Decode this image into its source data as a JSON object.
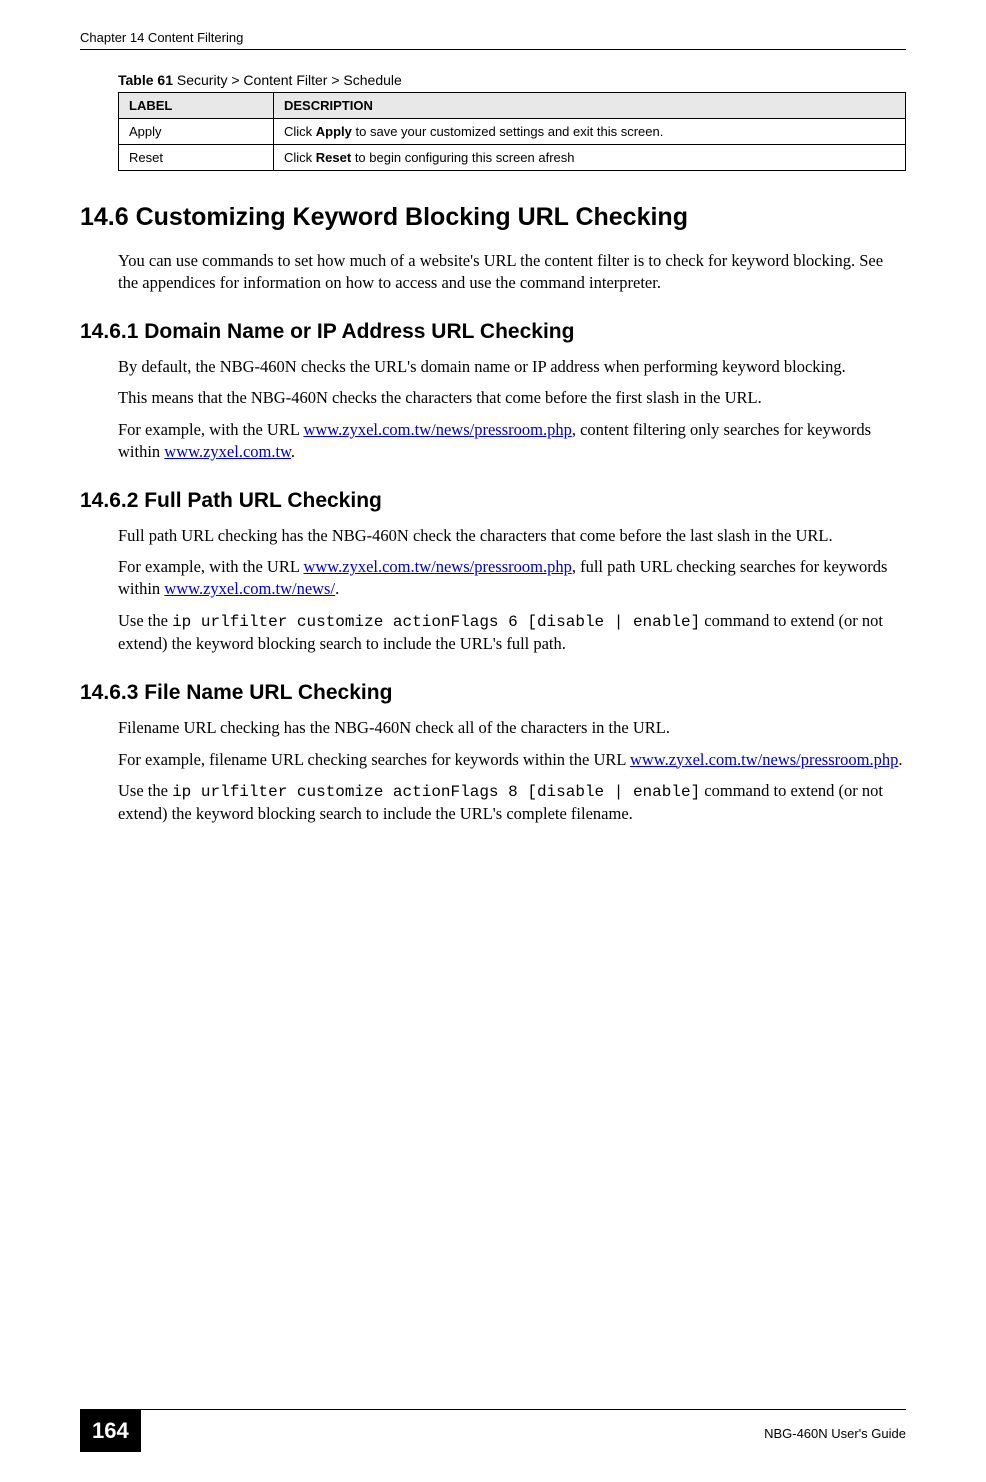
{
  "header": {
    "chapter": "Chapter 14 Content Filtering"
  },
  "table": {
    "caption_label": "Table 61",
    "caption_text": "   Security > Content Filter > Schedule",
    "headers": {
      "label": "LABEL",
      "description": "DESCRIPTION"
    },
    "rows": [
      {
        "label": "Apply",
        "desc_pre": "Click ",
        "desc_bold": "Apply",
        "desc_post": " to save your customized settings and exit this screen."
      },
      {
        "label": "Reset",
        "desc_pre": "Click ",
        "desc_bold": "Reset",
        "desc_post": " to begin configuring this screen afresh"
      }
    ]
  },
  "s146": {
    "title": "14.6  Customizing Keyword Blocking URL Checking",
    "p1": "You can use commands to set how much of a website's URL the content filter is to check for keyword blocking. See the appendices for information on how to access and use the command interpreter."
  },
  "s1461": {
    "title": "14.6.1  Domain Name or IP Address URL Checking",
    "p1": "By default, the NBG-460N checks the URL's domain name or IP address when performing keyword blocking.",
    "p2": "This means that the NBG-460N checks the characters that come before the first slash in the URL.",
    "p3a": "For example, with the URL ",
    "p3link1": "www.zyxel.com.tw/news/pressroom.php",
    "p3b": ", content filtering only searches for keywords within ",
    "p3link2": "www.zyxel.com.tw",
    "p3c": "."
  },
  "s1462": {
    "title": "14.6.2  Full Path URL Checking",
    "p1": "Full path URL checking has the NBG-460N check the characters that come before the last slash in the URL.",
    "p2a": "For example, with the URL ",
    "p2link1": "www.zyxel.com.tw/news/pressroom.php",
    "p2b": ", full path URL checking searches for keywords within ",
    "p2link2": "www.zyxel.com.tw/news/",
    "p2c": ".",
    "p3a": "Use the ",
    "p3cmd": "ip urlfilter customize actionFlags 6 [disable | enable]",
    "p3b": " command to extend (or not extend) the keyword blocking search to include the URL's full path."
  },
  "s1463": {
    "title": "14.6.3  File Name URL Checking",
    "p1": "Filename URL checking has the NBG-460N check all of the characters in the URL.",
    "p2a": "For example, filename URL checking searches for keywords within the URL ",
    "p2link": "www.zyxel.com.tw/news/pressroom.php",
    "p2b": ".",
    "p3a": "Use the ",
    "p3cmd": "ip urlfilter customize actionFlags 8 [disable | enable]",
    "p3b": " command to extend (or not extend) the keyword blocking search to include the URL's complete filename."
  },
  "footer": {
    "page": "164",
    "guide": "NBG-460N User's Guide"
  }
}
